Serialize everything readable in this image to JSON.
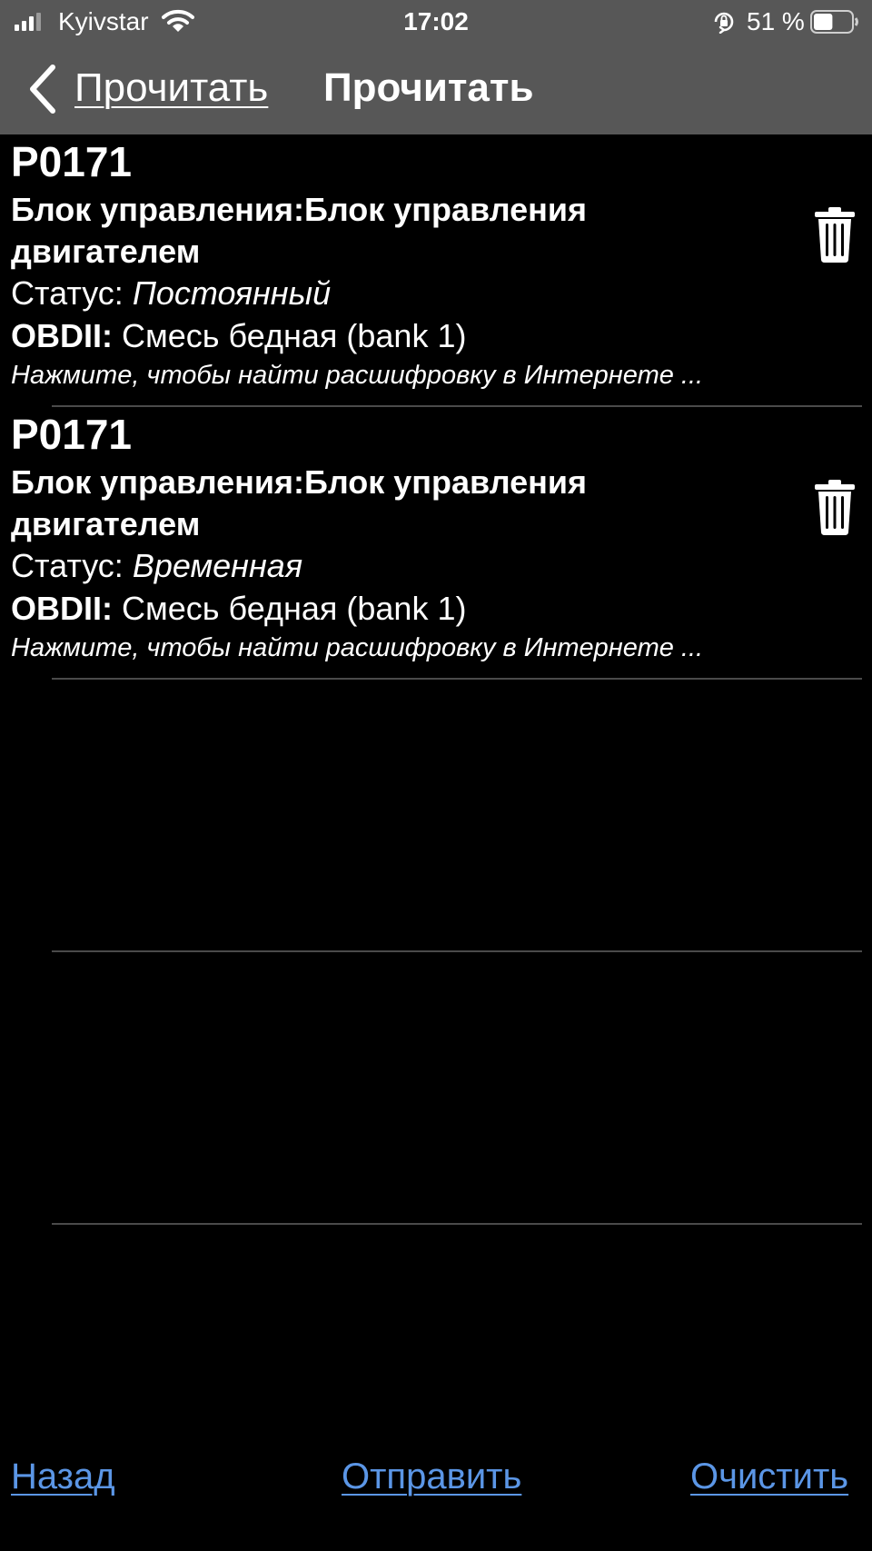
{
  "status_bar": {
    "carrier": "Kyivstar",
    "time": "17:02",
    "battery_percent": "51 %",
    "battery_level": 0.51
  },
  "nav": {
    "back_label": "Прочитать",
    "title": "Прочитать"
  },
  "entries": [
    {
      "code": "P0171",
      "ecu": "Блок управления:Блок управления двигателем",
      "status_label": "Статус:",
      "status_value": "Постоянный",
      "obd_label": "OBDII:",
      "obd_value": "Смесь бедная (bank 1)",
      "hint": "Нажмите, чтобы найти расшифровку в Интернете ..."
    },
    {
      "code": "P0171",
      "ecu": "Блок управления:Блок управления двигателем",
      "status_label": "Статус:",
      "status_value": "Временная",
      "obd_label": "OBDII:",
      "obd_value": "Смесь бедная (bank 1)",
      "hint": "Нажмите, чтобы найти расшифровку в Интернете ..."
    }
  ],
  "footer": {
    "back": "Назад",
    "send": "Отправить",
    "clear": "Очистить"
  },
  "colors": {
    "header_bg": "#575757",
    "link": "#5b96e6",
    "background": "#000000"
  }
}
